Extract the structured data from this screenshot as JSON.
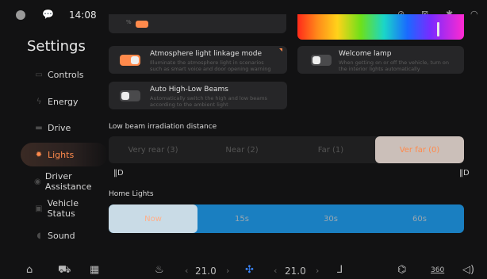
{
  "status_bar": {
    "time": "14:08"
  },
  "sidebar": {
    "title": "Settings",
    "items": [
      {
        "label": "Controls"
      },
      {
        "label": "Energy"
      },
      {
        "label": "Drive"
      },
      {
        "label": "Lights"
      },
      {
        "label": "Driver Assistance"
      },
      {
        "label": "Vehicle Status"
      },
      {
        "label": "Sound"
      }
    ],
    "active_index": 3
  },
  "content": {
    "partial_top_label": "%",
    "atmosphere": {
      "title": "Atmosphere light linkage mode",
      "desc": "Illuminate the atmosphere light in scenarios such as smart voice and door opening warning",
      "on": true
    },
    "welcome": {
      "title": "Welcome lamp",
      "desc": "When getting on or off the vehicle, turn on the interior lights automatically",
      "on": false
    },
    "auto_beams": {
      "title": "Auto High-Low Beams",
      "desc": "Automatically switch the high and low beams according to the ambient light",
      "on": false
    },
    "low_beam": {
      "label": "Low beam irradiation distance",
      "options": [
        "Very rear (3)",
        "Near (2)",
        "Far (1)",
        "Ver far (0)"
      ],
      "selected": 3
    },
    "home_lights": {
      "label": "Home Lights",
      "options": [
        "Now",
        "15s",
        "30s",
        "60s"
      ],
      "selected": 0
    }
  },
  "bottom_bar": {
    "temp_left": "21.0",
    "temp_right": "21.0",
    "camera_label": "360"
  },
  "colors": {
    "accent": "#ff8a4c",
    "background": "#121213",
    "card": "#262628"
  }
}
